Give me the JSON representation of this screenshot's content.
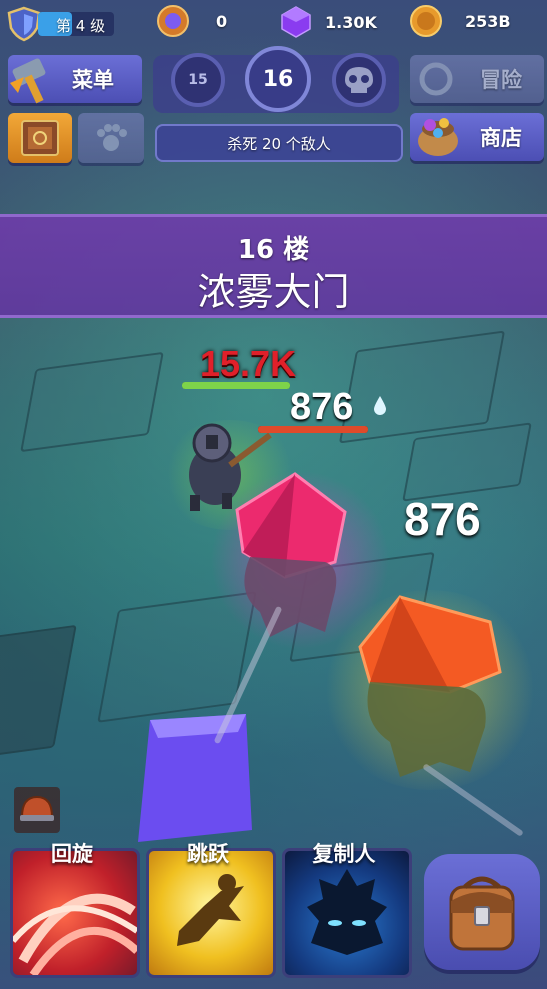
{
  "hud": {
    "level_label": "第 4 级",
    "token_count": "0",
    "gem_count": "1.30K",
    "gold_count": "253B"
  },
  "menu": {
    "menu_label": "菜单",
    "adventure_label": "冒险",
    "shop_label": "商店"
  },
  "floors": {
    "previous": "15",
    "current": "16",
    "objective": "杀死 20 个敌人"
  },
  "banner": {
    "floor_title": "16 楼",
    "area_name": "浓雾大门"
  },
  "combat": {
    "damage_crit": "15.7K",
    "damage_hit_1": "876",
    "damage_hit_2": "876",
    "player_health_fraction": 1.0,
    "enemy_health_fraction": 1.0
  },
  "skills": [
    {
      "label": "回旋",
      "icon": "spin-attack-icon"
    },
    {
      "label": "跳跃",
      "icon": "leap-icon"
    },
    {
      "label": "复制人",
      "icon": "clone-icon"
    }
  ],
  "colors": {
    "button_blue": "#5a5ec8",
    "banner_purple": "#6b3aa8",
    "crit_red": "#e0202a"
  }
}
